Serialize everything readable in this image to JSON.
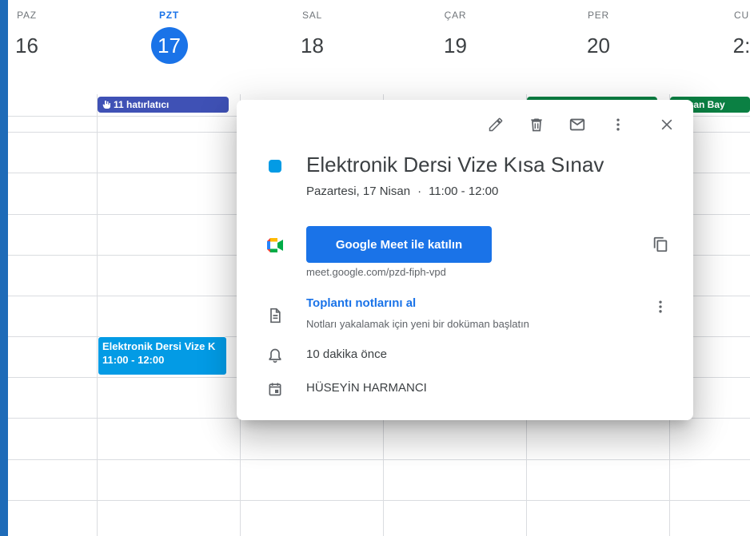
{
  "days": [
    {
      "name": "PAZ",
      "num": "16"
    },
    {
      "name": "PZT",
      "num": "17"
    },
    {
      "name": "SAL",
      "num": "18"
    },
    {
      "name": "ÇAR",
      "num": "19"
    },
    {
      "name": "PER",
      "num": "20"
    },
    {
      "name": "CU",
      "num": "2:"
    }
  ],
  "allday": {
    "reminder_label": "11 hatırlatıcı",
    "green_chip_2": "mazan Bay"
  },
  "event_block": {
    "title": "Elektronik Dersi Vize K",
    "time": "11:00 - 12:00"
  },
  "popup": {
    "title": "Elektronik Dersi Vize Kısa Sınav",
    "date": "Pazartesi, 17 Nisan",
    "separator": "·",
    "time": "11:00 - 12:00",
    "meet_button": "Google Meet ile katılın",
    "meet_link": "meet.google.com/pzd-fiph-vpd",
    "notes_link": "Toplantı notlarını al",
    "notes_sub": "Notları yakalamak için yeni bir doküman başlatın",
    "reminder": "10 dakika önce",
    "owner": "HÜSEYİN HARMANCI"
  },
  "colors": {
    "accent": "#1a73e8",
    "event": "#039be5",
    "reminder_chip": "#3f51b5",
    "holiday_chip": "#0b8043"
  }
}
